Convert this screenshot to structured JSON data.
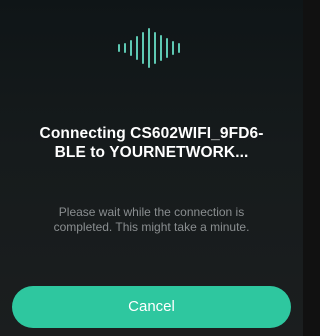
{
  "dialog": {
    "title_line1": "Connecting CS602WIFI_9FD6-",
    "title_line2": "BLE to  YOURNETWORK...",
    "message_line1": "Please wait while the connection is",
    "message_line2": "completed. This might take a minute.",
    "cancel_label": "Cancel"
  },
  "icons": {
    "waveform": "sound-wave-icon"
  },
  "colors": {
    "accent": "#2ec79f",
    "waveform": "#5ec9b3",
    "background": "#161b1c",
    "message_text": "#8a8e90"
  }
}
